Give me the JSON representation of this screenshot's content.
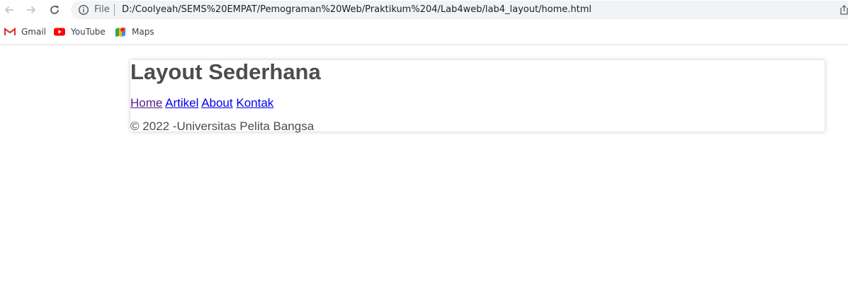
{
  "browser": {
    "omnibox": {
      "scheme_label": "File",
      "url": "D:/Coolyeah/SEMS%20EMPAT/Pemograman%20Web/Praktikum%204/Lab4web/lab4_layout/home.html"
    },
    "icons": {
      "back": "back-arrow-icon",
      "forward": "forward-arrow-icon",
      "reload": "reload-icon",
      "info": "info-icon"
    }
  },
  "bookmarks": [
    {
      "label": "Gmail",
      "icon": "gmail-icon"
    },
    {
      "label": "YouTube",
      "icon": "youtube-icon"
    },
    {
      "label": "Maps",
      "icon": "maps-icon"
    }
  ],
  "page": {
    "title": "Layout Sederhana",
    "nav": [
      "Home",
      "Artikel",
      "About",
      "Kontak"
    ],
    "footer": "© 2022 -Universitas Pelita Bangsa"
  },
  "colors": {
    "heading": "#4d4d4d",
    "link": "#0000ee",
    "visited_link": "#551a8b",
    "omnibox_bg": "#f1f3f4"
  }
}
